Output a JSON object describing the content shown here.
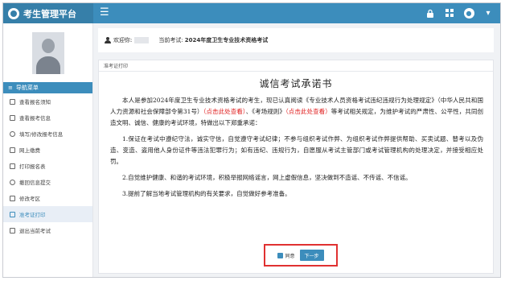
{
  "header": {
    "app_title": "考生管理平台",
    "menu_icon": "menu-icon",
    "lock_icon": "lock-icon",
    "grid_icon": "grid-icon",
    "user_icon": "user-circle-icon"
  },
  "sidebar": {
    "nav_header": "导航菜单",
    "items": [
      {
        "label": "查看报名须知",
        "icon": "doc-icon"
      },
      {
        "label": "查看报考信息",
        "icon": "doc-icon"
      },
      {
        "label": "填写/修改报考信息",
        "icon": "circle-check-icon"
      },
      {
        "label": "网上缴费",
        "icon": "doc-icon"
      },
      {
        "label": "打印报名表",
        "icon": "print-icon"
      },
      {
        "label": "撤回信息提交",
        "icon": "undo-icon"
      },
      {
        "label": "修改考区",
        "icon": "edit-icon"
      },
      {
        "label": "准考证打印",
        "icon": "doc-icon",
        "active": true
      },
      {
        "label": "退出当前考试",
        "icon": "exit-icon"
      }
    ]
  },
  "infobar": {
    "welcome_label": "欢迎你:",
    "current_exam_label": "当前考试:",
    "current_exam_value": "2024年度卫生专业技术资格考试"
  },
  "card": {
    "section_label": "准考证打印",
    "title": "诚信考试承诺书",
    "p1_a": "本人是参加2024年度卫生专业技术资格考试的考生，现已认真阅读《专业技术人员资格考试违纪违规行为处理规定》（中华人民共和国人力资源和社会保障部令第31号）",
    "p1_link1": "（点击此处查看）",
    "p1_b": "、《考场规则》",
    "p1_link2": "（点击此处查看）",
    "p1_c": "等考试相关规定，为维护考试的严肃性、公平性，共同创造文明、诚信、健康的考试环境，特做出以下郑重承诺：",
    "p2": "1.保证在考试中遵纪守法，诚实守信，自觉遵守考试纪律；不参与组织考试作弊、为组织考试作弊提供帮助、买卖试题、替考以及伪造、变造、盗用他人身份证件等违法犯罪行为；如有违纪、违规行为，自愿服从考试主管部门或考试管理机构的处理决定，并接受相应处罚。",
    "p3": "2.自觉维护健康、和谐的考试环境，积极举报网络谣言，网上虚假信息，坚决做到不造谣、不传谣、不信谣。",
    "p4": "3.提前了解当地考试管理机构的有关要求，自觉做好参考准备。",
    "agree_label": "同意",
    "next_label": "下一步"
  },
  "colors": {
    "primary": "#3c8dbc",
    "brand_bg": "#367fa9",
    "link_red": "#e02020",
    "highlight_border": "#e03131"
  }
}
